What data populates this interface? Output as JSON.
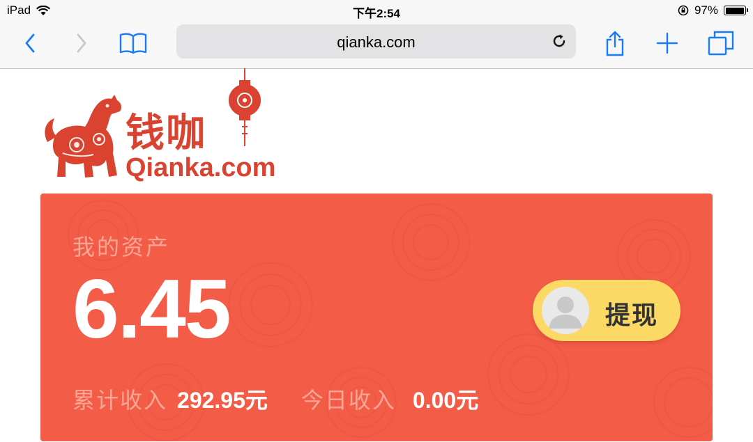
{
  "status_bar": {
    "device": "iPad",
    "time": "下午2:54",
    "battery": "97%",
    "battery_level": 0.97
  },
  "browser": {
    "url": "qianka.com",
    "icons": [
      "back-icon",
      "forward-icon",
      "bookmarks-icon",
      "reload-icon",
      "share-icon",
      "new-tab-icon",
      "tabs-icon"
    ]
  },
  "logo": {
    "cn": "钱咖",
    "en": "Qianka.com",
    "color": "#d94330"
  },
  "card": {
    "title": "我的资产",
    "balance": "6.45",
    "withdraw_label": "提现",
    "total_income_label": "累计收入",
    "total_income_value": "292.95元",
    "today_income_label": "今日收入",
    "today_income_value": "0.00元",
    "bg_color": "#f35d48",
    "button_color": "#fbd964"
  }
}
